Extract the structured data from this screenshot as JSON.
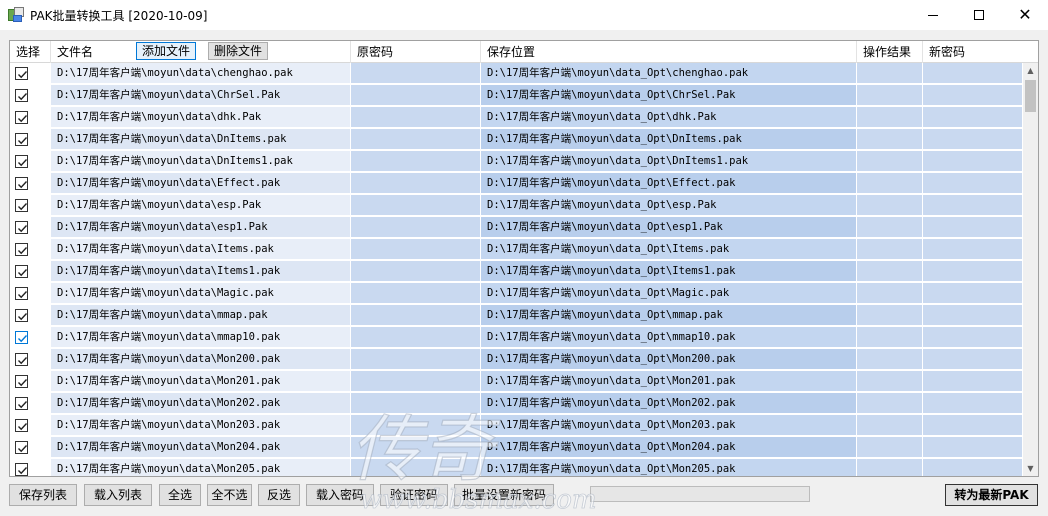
{
  "window": {
    "title": "PAK批量转换工具 [2020-10-09]"
  },
  "header": {
    "col_select": "选择",
    "col_filename": "文件名",
    "btn_add_file": "添加文件",
    "btn_delete_file": "删除文件",
    "col_orig_password": "原密码",
    "col_save_location": "保存位置",
    "col_result": "操作结果",
    "col_new_password": "新密码"
  },
  "rows": [
    {
      "checked": true,
      "file": "D:\\17周年客户端\\moyun\\data\\chenghao.pak",
      "orig_password": "",
      "save": "D:\\17周年客户端\\moyun\\data_Opt\\chenghao.pak",
      "result": "",
      "new_password": ""
    },
    {
      "checked": true,
      "file": "D:\\17周年客户端\\moyun\\data\\ChrSel.Pak",
      "orig_password": "",
      "save": "D:\\17周年客户端\\moyun\\data_Opt\\ChrSel.Pak",
      "result": "",
      "new_password": ""
    },
    {
      "checked": true,
      "file": "D:\\17周年客户端\\moyun\\data\\dhk.Pak",
      "orig_password": "",
      "save": "D:\\17周年客户端\\moyun\\data_Opt\\dhk.Pak",
      "result": "",
      "new_password": ""
    },
    {
      "checked": true,
      "file": "D:\\17周年客户端\\moyun\\data\\DnItems.pak",
      "orig_password": "",
      "save": "D:\\17周年客户端\\moyun\\data_Opt\\DnItems.pak",
      "result": "",
      "new_password": ""
    },
    {
      "checked": true,
      "file": "D:\\17周年客户端\\moyun\\data\\DnItems1.pak",
      "orig_password": "",
      "save": "D:\\17周年客户端\\moyun\\data_Opt\\DnItems1.pak",
      "result": "",
      "new_password": ""
    },
    {
      "checked": true,
      "file": "D:\\17周年客户端\\moyun\\data\\Effect.pak",
      "orig_password": "",
      "save": "D:\\17周年客户端\\moyun\\data_Opt\\Effect.pak",
      "result": "",
      "new_password": ""
    },
    {
      "checked": true,
      "file": "D:\\17周年客户端\\moyun\\data\\esp.Pak",
      "orig_password": "",
      "save": "D:\\17周年客户端\\moyun\\data_Opt\\esp.Pak",
      "result": "",
      "new_password": ""
    },
    {
      "checked": true,
      "file": "D:\\17周年客户端\\moyun\\data\\esp1.Pak",
      "orig_password": "",
      "save": "D:\\17周年客户端\\moyun\\data_Opt\\esp1.Pak",
      "result": "",
      "new_password": ""
    },
    {
      "checked": true,
      "file": "D:\\17周年客户端\\moyun\\data\\Items.pak",
      "orig_password": "",
      "save": "D:\\17周年客户端\\moyun\\data_Opt\\Items.pak",
      "result": "",
      "new_password": ""
    },
    {
      "checked": true,
      "file": "D:\\17周年客户端\\moyun\\data\\Items1.pak",
      "orig_password": "",
      "save": "D:\\17周年客户端\\moyun\\data_Opt\\Items1.pak",
      "result": "",
      "new_password": ""
    },
    {
      "checked": true,
      "file": "D:\\17周年客户端\\moyun\\data\\Magic.pak",
      "orig_password": "",
      "save": "D:\\17周年客户端\\moyun\\data_Opt\\Magic.pak",
      "result": "",
      "new_password": ""
    },
    {
      "checked": true,
      "file": "D:\\17周年客户端\\moyun\\data\\mmap.pak",
      "orig_password": "",
      "save": "D:\\17周年客户端\\moyun\\data_Opt\\mmap.pak",
      "result": "",
      "new_password": ""
    },
    {
      "checked": true,
      "focused": true,
      "file": "D:\\17周年客户端\\moyun\\data\\mmap10.pak",
      "orig_password": "",
      "save": "D:\\17周年客户端\\moyun\\data_Opt\\mmap10.pak",
      "result": "",
      "new_password": ""
    },
    {
      "checked": true,
      "file": "D:\\17周年客户端\\moyun\\data\\Mon200.pak",
      "orig_password": "",
      "save": "D:\\17周年客户端\\moyun\\data_Opt\\Mon200.pak",
      "result": "",
      "new_password": ""
    },
    {
      "checked": true,
      "file": "D:\\17周年客户端\\moyun\\data\\Mon201.pak",
      "orig_password": "",
      "save": "D:\\17周年客户端\\moyun\\data_Opt\\Mon201.pak",
      "result": "",
      "new_password": ""
    },
    {
      "checked": true,
      "file": "D:\\17周年客户端\\moyun\\data\\Mon202.pak",
      "orig_password": "",
      "save": "D:\\17周年客户端\\moyun\\data_Opt\\Mon202.pak",
      "result": "",
      "new_password": ""
    },
    {
      "checked": true,
      "file": "D:\\17周年客户端\\moyun\\data\\Mon203.pak",
      "orig_password": "",
      "save": "D:\\17周年客户端\\moyun\\data_Opt\\Mon203.pak",
      "result": "",
      "new_password": ""
    },
    {
      "checked": true,
      "file": "D:\\17周年客户端\\moyun\\data\\Mon204.pak",
      "orig_password": "",
      "save": "D:\\17周年客户端\\moyun\\data_Opt\\Mon204.pak",
      "result": "",
      "new_password": ""
    },
    {
      "checked": true,
      "file": "D:\\17周年客户端\\moyun\\data\\Mon205.pak",
      "orig_password": "",
      "save": "D:\\17周年客户端\\moyun\\data_Opt\\Mon205.pak",
      "result": "",
      "new_password": ""
    }
  ],
  "toolbar": {
    "save_list": "保存列表",
    "load_list": "载入列表",
    "select_all": "全选",
    "select_none": "全不选",
    "invert": "反选",
    "load_password": "载入密码",
    "verify_password": "验证密码",
    "batch_set_password": "批量设置新密码",
    "convert": "转为最新PAK"
  },
  "progress": {
    "value": 0
  },
  "watermark": {
    "text": "www.bbsmax.com",
    "glyphs": "传奇"
  },
  "colors": {
    "check_blue": "#0078d7",
    "progress_green": "#06b025"
  }
}
